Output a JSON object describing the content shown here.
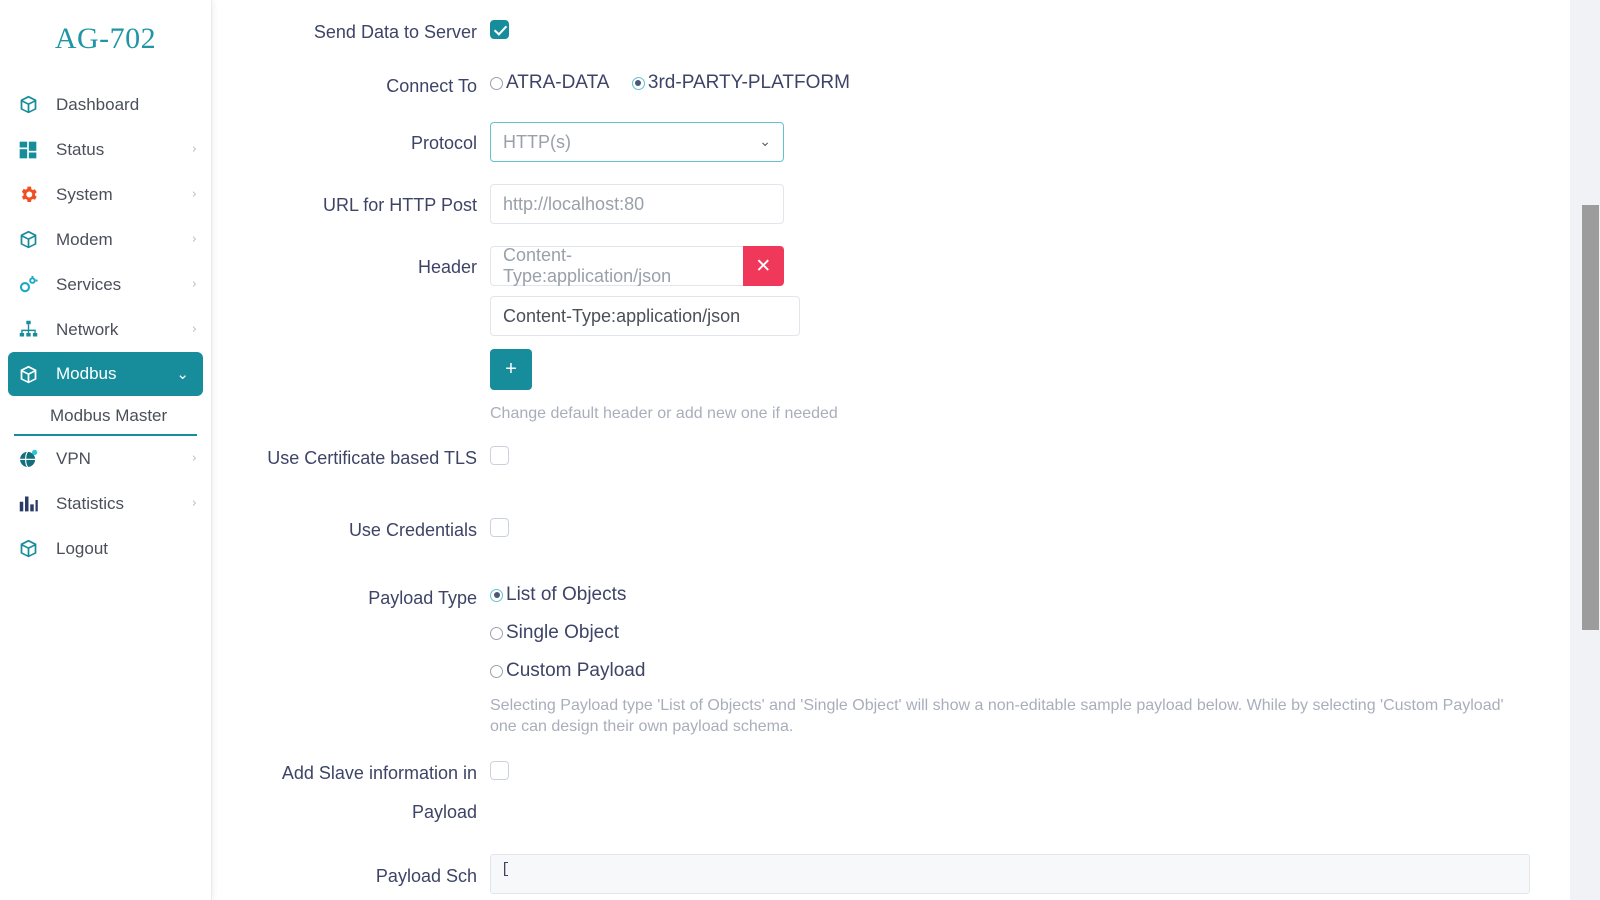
{
  "brand": {
    "title": "AG-702"
  },
  "sidebar": {
    "items": [
      {
        "label": "Dashboard",
        "icon": "cube-icon",
        "caret": "",
        "active": false,
        "name": "dashboard"
      },
      {
        "label": "Status",
        "icon": "grid-icon",
        "caret": "›",
        "active": false,
        "name": "status"
      },
      {
        "label": "System",
        "icon": "gear-icon",
        "caret": "›",
        "active": false,
        "name": "system"
      },
      {
        "label": "Modem",
        "icon": "cube-icon",
        "caret": "›",
        "active": false,
        "name": "modem"
      },
      {
        "label": "Services",
        "icon": "gears-icon",
        "caret": "›",
        "active": false,
        "name": "services"
      },
      {
        "label": "Network",
        "icon": "sitemap-icon",
        "caret": "›",
        "active": false,
        "name": "network"
      },
      {
        "label": "Modbus",
        "icon": "cube-icon",
        "caret": "⌄",
        "active": true,
        "name": "modbus"
      }
    ],
    "submenu": {
      "label": "Modbus Master",
      "name": "modbus-master"
    },
    "items_after": [
      {
        "label": "VPN",
        "icon": "globe-icon",
        "caret": "›",
        "active": false,
        "name": "vpn"
      },
      {
        "label": "Statistics",
        "icon": "barchart-icon",
        "caret": "›",
        "active": false,
        "name": "statistics"
      },
      {
        "label": "Logout",
        "icon": "cube-icon",
        "caret": "",
        "active": false,
        "name": "logout"
      }
    ]
  },
  "form": {
    "send_data": {
      "label": "Send Data to Server",
      "checked": true
    },
    "connect_to": {
      "label": "Connect To",
      "options": [
        {
          "label": "ATRA-DATA",
          "selected": false
        },
        {
          "label": "3rd-PARTY-PLATFORM",
          "selected": true
        }
      ]
    },
    "protocol": {
      "label": "Protocol",
      "value": "HTTP(s)",
      "chevron": "⌄"
    },
    "url": {
      "label": "URL for HTTP Post",
      "value": "http://localhost:80"
    },
    "header": {
      "label": "Header",
      "rows": [
        {
          "value": "Content-Type:application/json",
          "muted": true,
          "delete_label": "✕"
        },
        {
          "value": "Content-Type:application/json",
          "muted": false
        }
      ],
      "add_label": "+",
      "hint": "Change default header or add new one if needed"
    },
    "tls": {
      "label": "Use Certificate based TLS",
      "checked": false
    },
    "credentials": {
      "label": "Use Credentials",
      "checked": false
    },
    "payload_type": {
      "label": "Payload Type",
      "options": [
        {
          "label": "List of Objects",
          "selected": true
        },
        {
          "label": "Single Object",
          "selected": false
        },
        {
          "label": "Custom Payload",
          "selected": false
        }
      ],
      "hint": "Selecting Payload type 'List of Objects' and 'Single Object' will show a non-editable sample payload below. While by selecting 'Custom Payload' one can design their own payload schema."
    },
    "add_slave": {
      "label_line1": "Add Slave information in",
      "label_line2": "Payload",
      "checked": false
    },
    "payload_schema": {
      "label": "Payload Sch",
      "value": "["
    }
  },
  "colors": {
    "brand_teal": "#1f96a6",
    "accent_teal": "#178d9c",
    "danger_red": "#f0385b",
    "label_text": "#3d4466",
    "muted_text": "#a9aebb"
  }
}
